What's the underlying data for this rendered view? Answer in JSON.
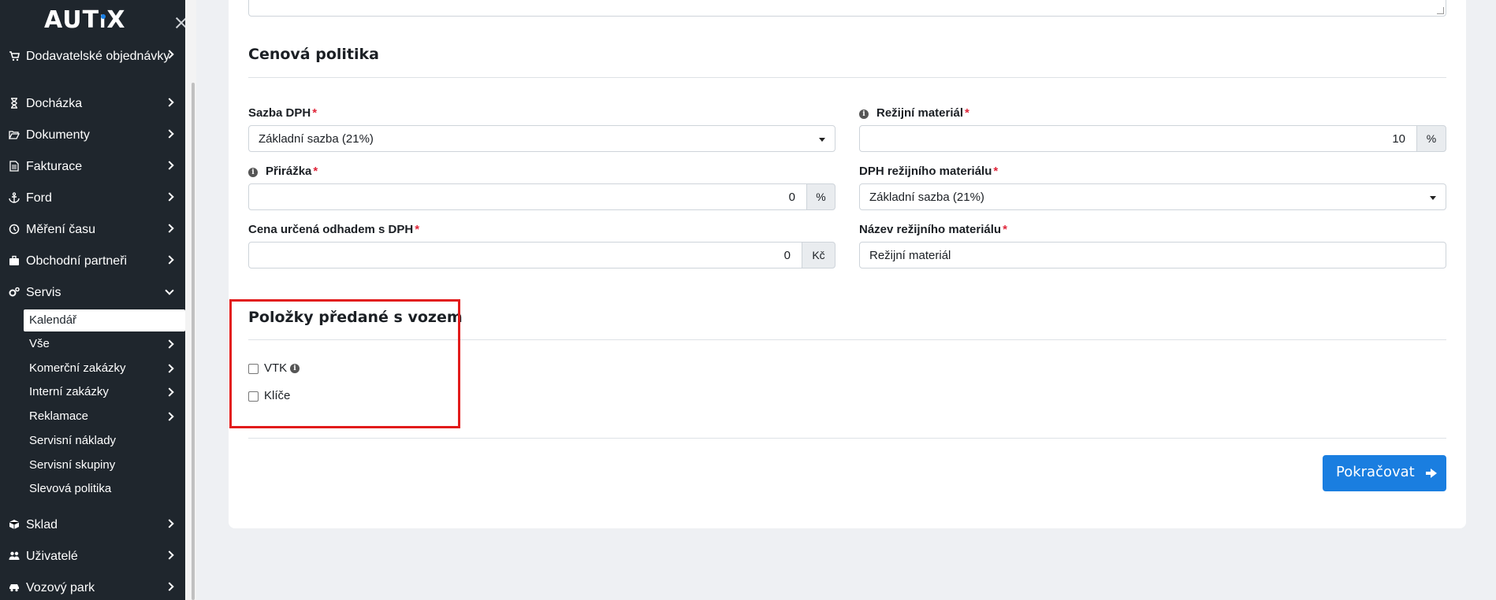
{
  "app": {
    "logo": "AUTiX"
  },
  "sidebar": {
    "items": [
      {
        "label": "Dodavatelské objednávky",
        "icon": "cart-icon"
      },
      {
        "label": "Docházka",
        "icon": "hourglass-icon"
      },
      {
        "label": "Dokumenty",
        "icon": "folder-open-icon"
      },
      {
        "label": "Fakturace",
        "icon": "file-text-icon"
      },
      {
        "label": "Ford",
        "icon": "anchor-icon"
      },
      {
        "label": "Měření času",
        "icon": "clock-icon"
      },
      {
        "label": "Obchodní partneři",
        "icon": "briefcase-icon"
      },
      {
        "label": "Servis",
        "icon": "gears-icon",
        "expanded": true
      },
      {
        "label": "Sklad",
        "icon": "cube-icon"
      },
      {
        "label": "Uživatelé",
        "icon": "users-icon"
      },
      {
        "label": "Vozový park",
        "icon": "car-icon"
      }
    ],
    "servis_sub": [
      {
        "label": "Kalendář",
        "active": true,
        "has_children": false
      },
      {
        "label": "Vše",
        "has_children": true
      },
      {
        "label": "Komerční zakázky",
        "has_children": true
      },
      {
        "label": "Interní zakázky",
        "has_children": true
      },
      {
        "label": "Reklamace",
        "has_children": true
      },
      {
        "label": "Servisní náklady",
        "has_children": false
      },
      {
        "label": "Servisní skupiny",
        "has_children": false
      },
      {
        "label": "Slevová politika",
        "has_children": false
      }
    ]
  },
  "pricing": {
    "title": "Cenová politika",
    "vat_rate": {
      "label": "Sazba DPH",
      "value": "Základní sazba (21%)"
    },
    "overhead": {
      "label": "Režijní materiál",
      "value": "10",
      "unit": "%"
    },
    "surcharge": {
      "label": "Přirážka",
      "value": "0",
      "unit": "%"
    },
    "overhead_vat": {
      "label": "DPH režijního materiálu",
      "value": "Základní sazba (21%)"
    },
    "estimate": {
      "label": "Cena určená odhadem s DPH",
      "value": "0",
      "unit": "Kč"
    },
    "overhead_name": {
      "label": "Název režijního materiálu",
      "value": "Režijní materiál"
    },
    "required_mark": "*"
  },
  "handover": {
    "title": "Položky předané s vozem",
    "items": [
      {
        "label": "VTK",
        "checked": false,
        "info": true
      },
      {
        "label": "Klíče",
        "checked": false,
        "info": false
      }
    ]
  },
  "actions": {
    "continue_label": "Pokračovat"
  },
  "colors": {
    "primary": "#1a7ee0",
    "required": "#e0263a",
    "highlight": "#e21b1b",
    "sidebar_bg": "#1f262d"
  }
}
